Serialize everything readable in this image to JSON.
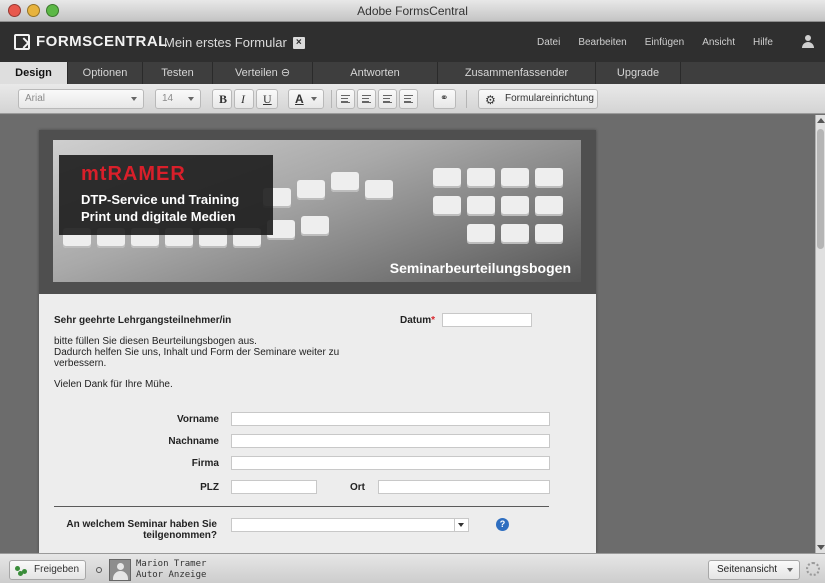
{
  "window": {
    "title": "Adobe FormsCentral"
  },
  "app": {
    "logo": "FORMSCENTRAL",
    "form_name": "Mein erstes Formular"
  },
  "menu": [
    "Datei",
    "Bearbeiten",
    "Einfügen",
    "Ansicht",
    "Hilfe"
  ],
  "tabs": [
    "Design",
    "Optionen",
    "Testen",
    "Verteilen",
    "Antworten anzeigen",
    "Zusammenfassender Bericht",
    "Upgrade"
  ],
  "toolbar": {
    "font": "Arial",
    "size": "14",
    "bold": "B",
    "italic": "I",
    "underline": "U",
    "color": "A",
    "form_setup": "Formulareinrichtung"
  },
  "banner": {
    "logo": "mtRAMER",
    "line1": "DTP-Service und Training",
    "line2": "Print und digitale Medien",
    "title": "Seminarbeurteilungsbogen"
  },
  "form": {
    "greeting": "Sehr geehrte Lehrgangsteilnehmer/in",
    "datum_label": "Datum",
    "required_mark": "*",
    "intro_lines": [
      "bitte füllen Sie diesen Beurteilungsbogen aus.",
      "Dadurch helfen Sie uns, Inhalt und Form der Seminare weiter zu",
      "verbessern."
    ],
    "thanks": "Vielen Dank für Ihre Mühe.",
    "fields": {
      "vorname": "Vorname",
      "nachname": "Nachname",
      "firma": "Firma",
      "plz": "PLZ",
      "ort": "Ort"
    },
    "question": "An welchem Seminar haben Sie teilgenommen?",
    "help": "?"
  },
  "status": {
    "share": "Freigeben",
    "user_name": "Marion Tramer",
    "user_role": "Autor Anzeige",
    "view": "Seitenansicht"
  },
  "colors": {
    "accent_red": "#d91f2a",
    "help_blue": "#2e6ec0",
    "header_dark": "#2f2f2f"
  }
}
